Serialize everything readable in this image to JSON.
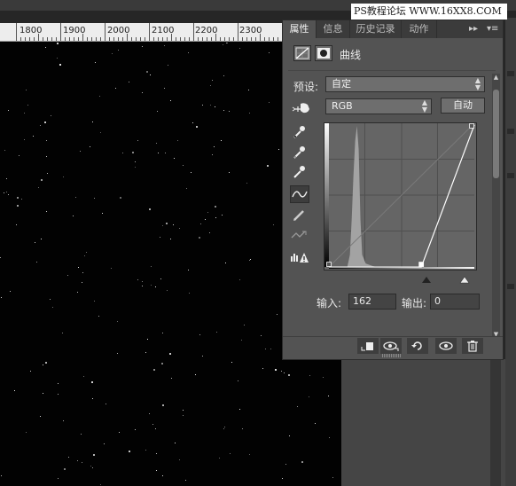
{
  "watermark": "PS教程论坛 WWW.16XX8.COM",
  "ruler": {
    "labels": [
      "1800",
      "1900",
      "2000",
      "2100",
      "2200",
      "2300"
    ]
  },
  "panel": {
    "tabs": [
      "属性",
      "信息",
      "历史记录",
      "动作"
    ],
    "active_tab": "属性",
    "collapse_glyph": "▸▸",
    "menu_glyph": "▾≡",
    "title": "曲线",
    "preset_label": "预设:",
    "preset_value": "自定",
    "channel_value": "RGB",
    "auto_button": "自动",
    "input_label": "输入:",
    "input_value": "162",
    "output_label": "输出:",
    "output_value": "0",
    "tools": [
      "eyedropper-black-icon",
      "eyedropper-gray-icon",
      "eyedropper-white-icon",
      "curve-points-icon",
      "pencil-icon",
      "smooth-icon",
      "clipping-warning-icon"
    ],
    "bottom_buttons": [
      "clip-to-layer-icon",
      "view-previous-icon",
      "reset-icon",
      "visibility-icon",
      "trash-icon"
    ]
  },
  "curve": {
    "points": [
      [
        0,
        0
      ],
      [
        162,
        0
      ],
      [
        255,
        255
      ]
    ],
    "range": [
      0,
      255
    ]
  },
  "colors": {
    "panel_bg": "#535353",
    "tab_bar": "#3b3b3b",
    "canvas": "#020202"
  }
}
